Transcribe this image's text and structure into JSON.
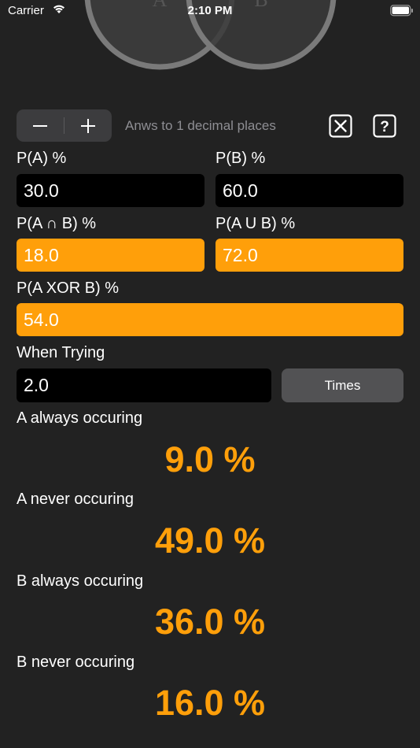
{
  "status_bar": {
    "carrier": "Carrier",
    "time": "2:10 PM"
  },
  "venn": {
    "circle_a_label": "A",
    "circle_b_label": "B",
    "circle_stroke_color": "#7a7a7a",
    "circle_fill_color": "#3a3a3a"
  },
  "toolbar": {
    "decrement_icon": "minus-icon",
    "increment_icon": "plus-icon",
    "decimals_text": "Anws to 1 decimal places",
    "clear_icon": "x-square-icon",
    "help_icon": "question-square-icon"
  },
  "fields": {
    "pa_label": "P(A) %",
    "pa_value": "30.0",
    "pb_label": "P(B) %",
    "pb_value": "60.0",
    "intersection_label": "P(A ∩ B) %",
    "intersection_value": "18.0",
    "union_label": "P(A U B) %",
    "union_value": "72.0",
    "xor_label": "P(A XOR B) %",
    "xor_value": "54.0",
    "trying_label": "When Trying",
    "trying_value": "2.0",
    "times_button": "Times"
  },
  "results": {
    "a_always_label": "A always occuring",
    "a_always_value": "9.0 %",
    "a_never_label": "A never occuring",
    "a_never_value": "49.0 %",
    "b_always_label": "B always occuring",
    "b_always_value": "36.0 %",
    "b_never_label": "B never occuring",
    "b_never_value": "16.0 %"
  },
  "colors": {
    "background": "#222222",
    "accent_orange": "#ff9f0a",
    "input_background": "#000000",
    "button_gray": "#525254"
  }
}
